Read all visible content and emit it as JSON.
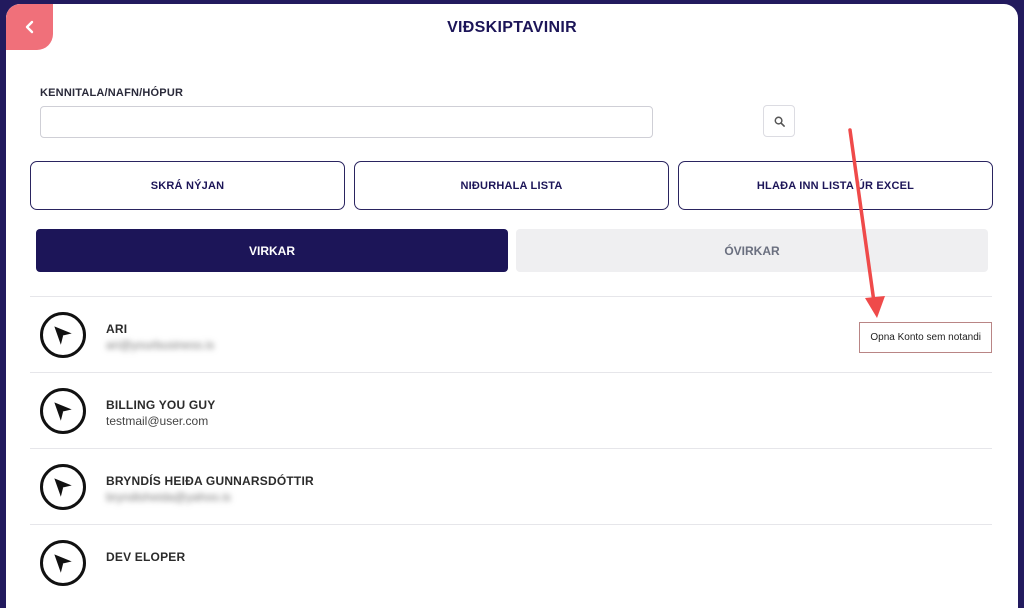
{
  "header": {
    "title": "VIÐSKIPTAVINIR",
    "back_icon": "chevron-left-icon"
  },
  "search": {
    "label": "KENNITALA/NAFN/HÓPUR",
    "value": "",
    "placeholder": "",
    "button_icon": "search-icon"
  },
  "actions": {
    "register_label": "SKRÁ NÝJAN",
    "download_label": "NIÐURHALA LISTA",
    "import_label": "HLAÐA INN LISTA ÚR EXCEL"
  },
  "tabs": {
    "active_label": "VIRKAR",
    "inactive_label": "ÓVIRKAR"
  },
  "customers": [
    {
      "name": "ARI",
      "email": "ari@yourbusiness.is",
      "email_blurred": true,
      "avatar_icon": "paper-plane-icon"
    },
    {
      "name": "BILLING YOU GUY",
      "email": "testmail@user.com",
      "email_blurred": false,
      "avatar_icon": "paper-plane-icon"
    },
    {
      "name": "BRYNDÍS HEIÐA GUNNARSDÓTTIR",
      "email": "bryndisheida@yahoo.is",
      "email_blurred": true,
      "avatar_icon": "paper-plane-icon"
    },
    {
      "name": "DEV ELOPER",
      "email": "",
      "email_blurred": false,
      "avatar_icon": "paper-plane-icon"
    }
  ],
  "row_action": {
    "open_as_user_label": "Opna Konto sem notandi"
  },
  "colors": {
    "brand_dark": "#1c1558",
    "page_background": "#221a5e",
    "back_button": "#f0707a",
    "annotation_arrow": "#ef4a4a",
    "inactive_tab": "#efeff1"
  }
}
